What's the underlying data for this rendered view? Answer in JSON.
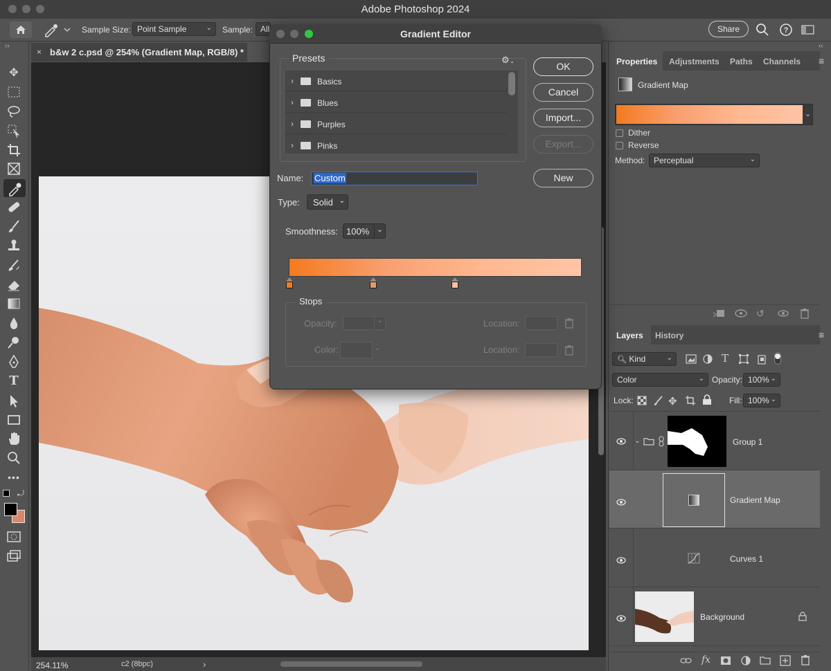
{
  "app": {
    "title": "Adobe Photoshop 2024"
  },
  "options_bar": {
    "sample_size_label": "Sample Size:",
    "sample_size_value": "Point Sample",
    "sample_label": "Sample:",
    "sample_value": "All",
    "share_label": "Share"
  },
  "document": {
    "tab_title": "b&w 2 c.psd @ 254% (Gradient Map, RGB/8) *",
    "close_glyph": "×",
    "zoom": "254.11%",
    "info": "c2 (8bpc)",
    "info_arrow": "›"
  },
  "gradient_editor": {
    "title": "Gradient Editor",
    "presets_label": "Presets",
    "presets": [
      {
        "label": "Basics"
      },
      {
        "label": "Blues"
      },
      {
        "label": "Purples"
      },
      {
        "label": "Pinks"
      }
    ],
    "buttons": {
      "ok": "OK",
      "cancel": "Cancel",
      "import": "Import...",
      "export": "Export...",
      "new": "New"
    },
    "name_label": "Name:",
    "name_value": "Custom",
    "type_label": "Type:",
    "type_value": "Solid",
    "smoothness_label": "Smoothness:",
    "smoothness_value": "100%",
    "gradient_colors": [
      "#f47a20",
      "#f9a070",
      "#ffb890",
      "#ffc4a6"
    ],
    "color_stops": [
      {
        "color": "#f47a20",
        "location": 0
      },
      {
        "color": "#e8966a",
        "location": 0.286
      },
      {
        "color": "#ffc0a0",
        "location": 0.566
      }
    ],
    "stops_label": "Stops",
    "opacity_label": "Opacity:",
    "location_label": "Location:",
    "color_label": "Color:"
  },
  "properties_panel": {
    "tabs": [
      "Properties",
      "Adjustments",
      "Paths",
      "Channels"
    ],
    "layer_type": "Gradient Map",
    "dither_label": "Dither",
    "reverse_label": "Reverse",
    "method_label": "Method:",
    "method_value": "Perceptual"
  },
  "layers_panel": {
    "tabs": [
      "Layers",
      "History"
    ],
    "kind_value": "Kind",
    "blend_mode": "Color",
    "opacity_label": "Opacity:",
    "opacity_value": "100%",
    "lock_label": "Lock:",
    "fill_label": "Fill:",
    "fill_value": "100%",
    "layers": [
      {
        "name": "Group 1"
      },
      {
        "name": "Gradient Map"
      },
      {
        "name": "Curves 1"
      },
      {
        "name": "Background"
      }
    ]
  },
  "icons": {
    "close": "×",
    "chevron_right": "›",
    "chevron_down": "⌄",
    "gear": "⚙",
    "trash": "🗑",
    "eye": "👁",
    "lock": "🔒"
  },
  "colors": {
    "accent_orange": "#f47a20",
    "foreground": "#000000",
    "background_swatch": "#d9866a"
  }
}
